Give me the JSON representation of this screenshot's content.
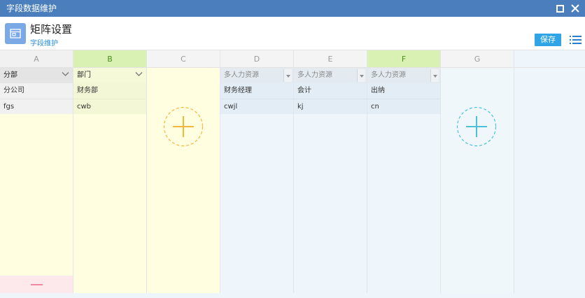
{
  "window": {
    "title": "字段数据维护"
  },
  "header": {
    "title": "矩阵设置",
    "subtitle": "字段维护",
    "save_label": "保存"
  },
  "columns": [
    {
      "letter": "A",
      "field": "分部",
      "rows": [
        "分公司",
        "fgs"
      ]
    },
    {
      "letter": "B",
      "field": "部门",
      "rows": [
        "财务部",
        "cwb"
      ]
    },
    {
      "letter": "C"
    },
    {
      "letter": "D",
      "field": "多人力资源",
      "rows": [
        "财务经理",
        "cwjl"
      ]
    },
    {
      "letter": "E",
      "field": "多人力资源",
      "rows": [
        "会计",
        "kj"
      ]
    },
    {
      "letter": "F",
      "field": "多人力资源",
      "rows": [
        "出纳",
        "cn"
      ]
    },
    {
      "letter": "G"
    }
  ],
  "colors": {
    "titlebar": "#4a7ebd",
    "save_button": "#2fa4e7",
    "condition_area": "#fffee0",
    "result_area": "#eef6fb",
    "selected_header": "#d9f2b4",
    "add_condition": "#f5b73b",
    "add_result": "#4cc1d8",
    "remove": "#f08aa0"
  }
}
